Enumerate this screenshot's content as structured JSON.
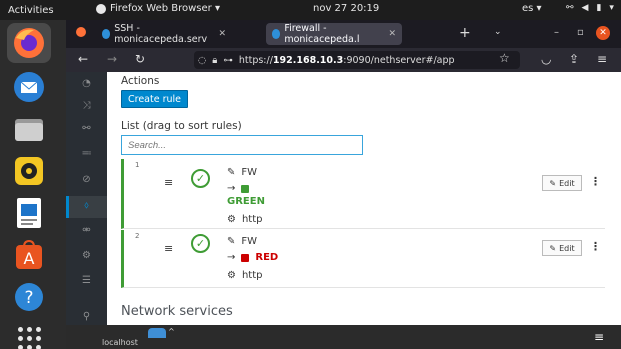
{
  "topbar": {
    "activities": "Activities",
    "app": "Firefox Web Browser ▾",
    "clock": "nov 27  20:19",
    "lang": "es ▾"
  },
  "browser": {
    "tabs": [
      {
        "label": "SSH - monicacepeda.serv"
      },
      {
        "label": "Firewall - monicacepeda.l"
      }
    ],
    "url_prefix": "https://",
    "url_host": "192.168.10.3",
    "url_rest": ":9090/nethserver#/app"
  },
  "page": {
    "actions_label": "Actions",
    "create_rule_label": "Create rule",
    "list_label": "List (drag to sort rules)",
    "search_placeholder": "Search...",
    "network_services_label": "Network services",
    "rules": [
      {
        "num": "1",
        "source": "FW",
        "dest": "GREEN",
        "dest_color": "#3f9c35",
        "service": "http",
        "edit": "Edit"
      },
      {
        "num": "2",
        "source": "FW",
        "dest": "RED",
        "dest_color": "#cc0000",
        "service": "http",
        "edit": "Edit"
      }
    ]
  },
  "bottom": {
    "host": "localhost"
  }
}
